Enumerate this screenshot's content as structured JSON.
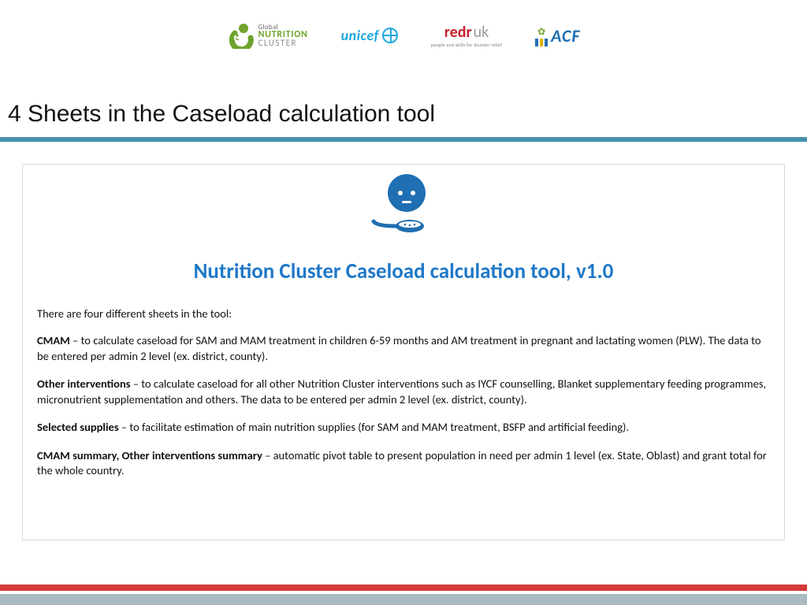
{
  "logos": {
    "gnc": {
      "line1": "Global",
      "line2": "NUTRITION",
      "line3": "CLUSTER"
    },
    "unicef": "unicef",
    "redr": {
      "main1": "redr",
      "main2": "uk",
      "tagline": "people and skills for disaster relief"
    },
    "acf": "ACF"
  },
  "page_title": "4 Sheets in the Caseload calculation tool",
  "tool_title": "Nutrition Cluster Caseload calculation tool, v1.0",
  "intro": "There are four different sheets in the tool:",
  "items": [
    {
      "name": "CMAM",
      "desc": " – to calculate caseload for SAM and MAM treatment in children 6-59 months and AM treatment in pregnant and lactating women (PLW). The data to be entered per admin 2 level (ex. district, county)."
    },
    {
      "name": "Other interventions",
      "desc": " – to calculate caseload for all other Nutrition Cluster interventions such as IYCF counselling, Blanket supplementary feeding programmes, micronutrient supplementation and others. The data to be entered per admin 2 level (ex. district, county)."
    },
    {
      "name": "Selected supplies",
      "desc": " – to facilitate estimation of main nutrition supplies (for SAM and MAM treatment, BSFP and artificial feeding)."
    },
    {
      "name": "CMAM summary, Other interventions summary",
      "desc": " – automatic pivot table to present population in need per admin 1 level (ex. State, Oblast) and grant total for the whole country."
    }
  ],
  "colors": {
    "rule": "#4591ac",
    "title": "#1f78c8",
    "footer_red": "#d43a3a",
    "footer_grey": "#a9b9c0"
  }
}
